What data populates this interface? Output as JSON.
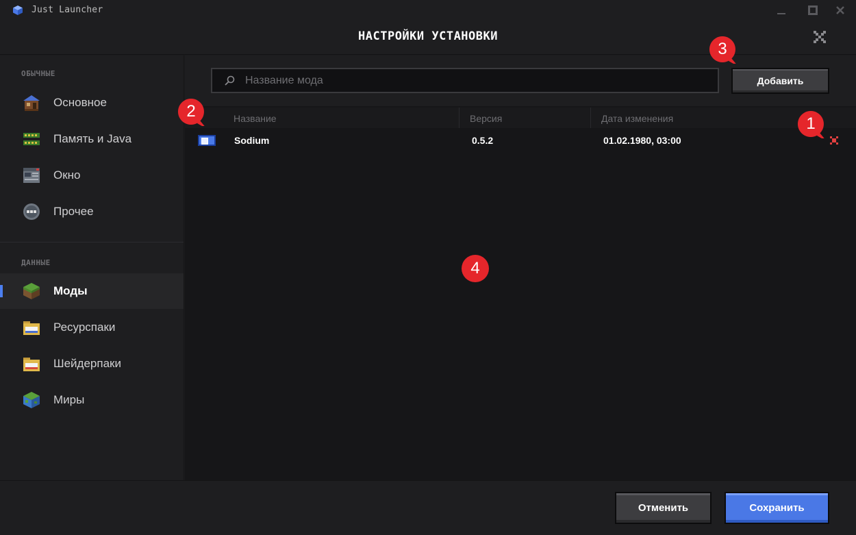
{
  "window": {
    "title": "Just Launcher"
  },
  "header": {
    "title": "НАСТРОЙКИ УСТАНОВКИ"
  },
  "sidebar": {
    "sections": [
      {
        "title": "ОБЫЧНЫЕ",
        "items": [
          {
            "label": "Основное",
            "icon": "house-icon"
          },
          {
            "label": "Память и Java",
            "icon": "memory-icon"
          },
          {
            "label": "Окно",
            "icon": "window-icon"
          },
          {
            "label": "Прочее",
            "icon": "more-icon"
          }
        ]
      },
      {
        "title": "ДАННЫЕ",
        "items": [
          {
            "label": "Моды",
            "icon": "grass-block-icon",
            "active": true
          },
          {
            "label": "Ресурспаки",
            "icon": "folder-icon"
          },
          {
            "label": "Шейдерпаки",
            "icon": "folder-red-icon"
          },
          {
            "label": "Миры",
            "icon": "globe-icon"
          }
        ]
      }
    ]
  },
  "main": {
    "search": {
      "placeholder": "Название мода",
      "value": ""
    },
    "add_label": "Добавить",
    "table": {
      "columns": [
        "Название",
        "Версия",
        "Дата изменения"
      ],
      "rows": [
        {
          "enabled": true,
          "name": "Sodium",
          "version": "0.5.2",
          "modified": "01.02.1980, 03:00"
        }
      ]
    }
  },
  "footer": {
    "cancel_label": "Отменить",
    "save_label": "Сохранить"
  },
  "annotations": [
    "1",
    "2",
    "3",
    "4"
  ],
  "colors": {
    "accent": "#4c7ff0",
    "marker": "#e5262b",
    "delete": "#e04040"
  }
}
